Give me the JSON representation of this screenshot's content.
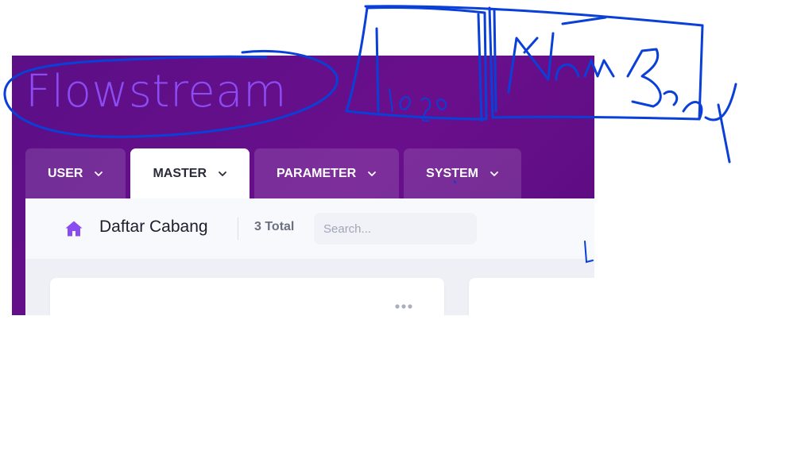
{
  "app": {
    "brand": "Flowstream"
  },
  "nav": {
    "tabs": [
      {
        "label": "USER",
        "active": false
      },
      {
        "label": "MASTER",
        "active": true
      },
      {
        "label": "PARAMETER",
        "active": false
      },
      {
        "label": "SYSTEM",
        "active": false
      }
    ]
  },
  "toolbar": {
    "icon": "home-icon",
    "title": "Daftar Cabang",
    "total": "3 Total",
    "search_placeholder": "Search..."
  },
  "cards": [
    {
      "menu_icon": "more-horizontal-icon"
    },
    {}
  ],
  "annotations": {
    "logo_note": "Logo",
    "name_note": "Nama Bank",
    "color": "#0a3fd8"
  },
  "colors": {
    "header_bg": "#5e0e87",
    "brand": "#8b4cf4",
    "home_icon": "#8a4bf0",
    "active_tab_bg": "#ffffff",
    "content_bg": "#eef0f6"
  }
}
